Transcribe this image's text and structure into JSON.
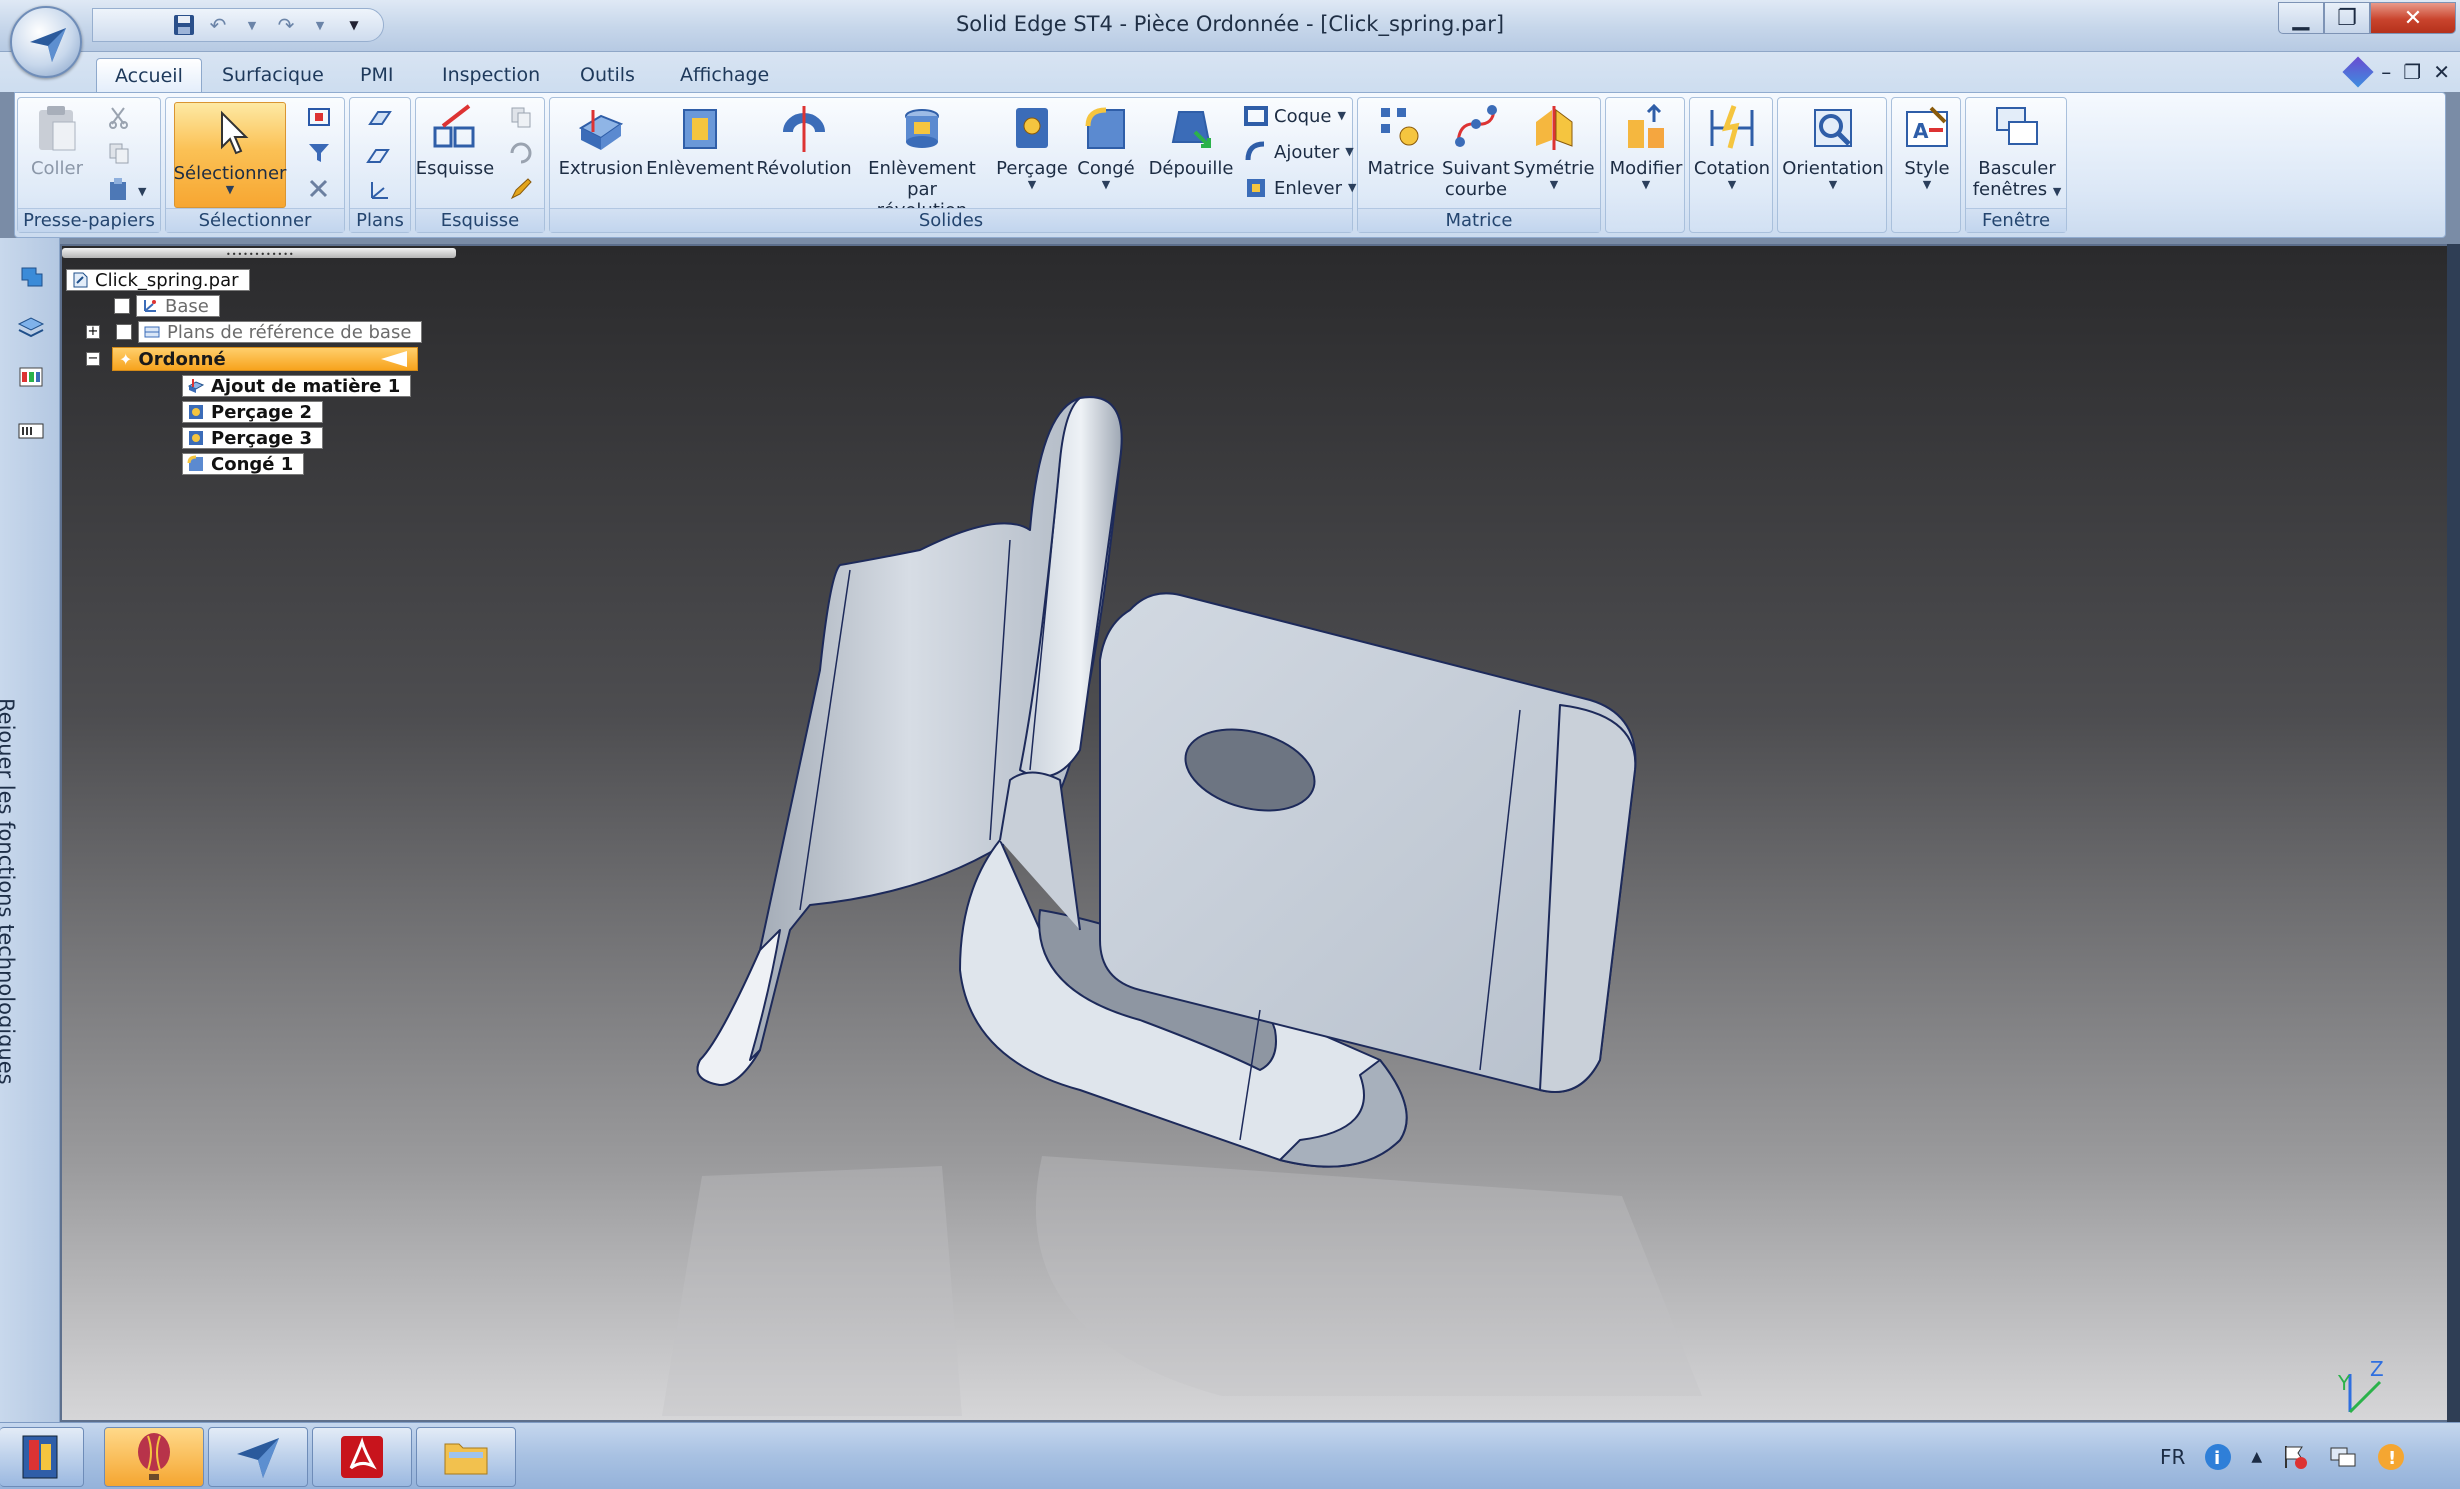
{
  "window": {
    "title": "Solid Edge ST4 - Pièce Ordonnée - [Click_spring.par]",
    "min": "▁",
    "max": "❐",
    "close": "✕"
  },
  "qat": {
    "save_icon": "save-icon",
    "undo_icon": "undo-icon",
    "redo_icon": "redo-icon"
  },
  "tabs": [
    "Accueil",
    "Surfacique",
    "PMI",
    "Inspection",
    "Outils",
    "Affichage"
  ],
  "doc_controls": {
    "min": "–",
    "restore": "❐",
    "close": "✕"
  },
  "ribbon": {
    "groups": {
      "presse_papiers": "Presse-papiers",
      "selectionner": "Sélectionner",
      "plans": "Plans",
      "esquisse": "Esquisse",
      "solides": "Solides",
      "matrice": "Matrice",
      "fenetre": "Fenêtre"
    },
    "buttons": {
      "coller": "Coller",
      "selectionner": "Sélectionner",
      "esquisse": "Esquisse",
      "extrusion": "Extrusion",
      "enlevement": "Enlèvement",
      "revolution": "Révolution",
      "enlevement_rev_1": "Enlèvement par",
      "enlevement_rev_2": "révolution",
      "percage": "Perçage",
      "conge": "Congé",
      "depouille": "Dépouille",
      "coque": "Coque",
      "ajouter": "Ajouter",
      "enlever": "Enlever",
      "matrice": "Matrice",
      "suivant_1": "Suivant",
      "suivant_2": "courbe",
      "symetrie": "Symétrie",
      "modifier": "Modifier",
      "cotation": "Cotation",
      "orientation": "Orientation",
      "style": "Style",
      "basculer_1": "Basculer",
      "basculer_2": "fenêtres"
    }
  },
  "sidebar": {
    "rejouer": "Rejouer les fonctions technologiques"
  },
  "tree": {
    "root": "Click_spring.par",
    "base": "Base",
    "plans": "Plans de référence de base",
    "ordonne": "Ordonné",
    "features": [
      "Ajout de matière 1",
      "Perçage 2",
      "Perçage 3",
      "Congé 1"
    ]
  },
  "triad": {
    "z": "Z",
    "y": "Y"
  },
  "taskbar": {
    "lang": "FR"
  },
  "colors": {
    "accent": "#f7a631",
    "ribbon": "#dbe7f6",
    "viewport_top": "#2a2a2c",
    "viewport_bottom": "#d6d6d8"
  }
}
